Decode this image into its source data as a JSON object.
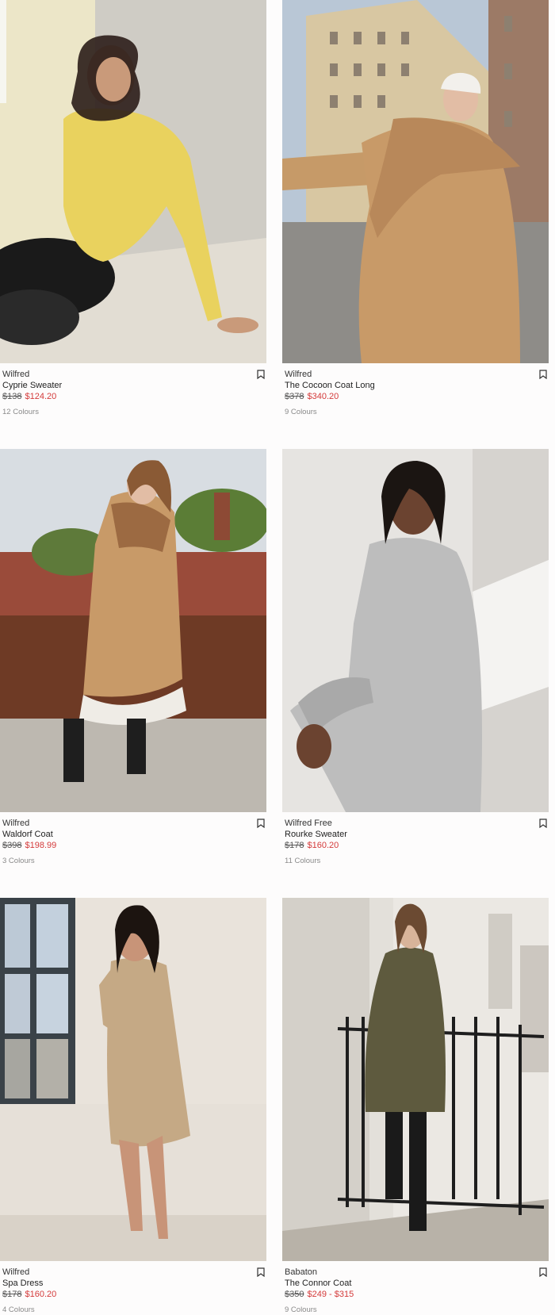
{
  "products": [
    {
      "brand": "Wilfred",
      "name": "Cyprie Sweater",
      "original_price": "$138",
      "sale_price": "$124.20",
      "colours": "12 Colours",
      "image": "woman in yellow turtleneck sweater sitting on floor"
    },
    {
      "brand": "Wilfred",
      "name": "The Cocoon Coat Long",
      "original_price": "$378",
      "sale_price": "$340.20",
      "colours": "9 Colours",
      "image": "woman in camel coat and scarf on street"
    },
    {
      "brand": "Wilfred",
      "name": "Waldorf Coat",
      "original_price": "$398",
      "sale_price": "$198.99",
      "colours": "3 Colours",
      "image": "woman in camel belted coat with fur collar on rooftop"
    },
    {
      "brand": "Wilfred Free",
      "name": "Rourke Sweater",
      "original_price": "$178",
      "sale_price": "$160.20",
      "colours": "11 Colours",
      "image": "woman in grey knit long cardigan"
    },
    {
      "brand": "Wilfred",
      "name": "Spa Dress",
      "original_price": "$178",
      "sale_price": "$160.20",
      "colours": "4 Colours",
      "image": "woman in beige knit button dress by window"
    },
    {
      "brand": "Babaton",
      "name": "The Connor Coat",
      "original_price": "$350",
      "sale_price": "$249 - $315",
      "colours": "9 Colours",
      "image": "woman in olive wrap coat by iron fence"
    }
  ],
  "icons": {
    "wishlist": "bookmark-icon"
  },
  "colors": {
    "sale": "#d43b3b",
    "background": "#fdfcfc"
  }
}
